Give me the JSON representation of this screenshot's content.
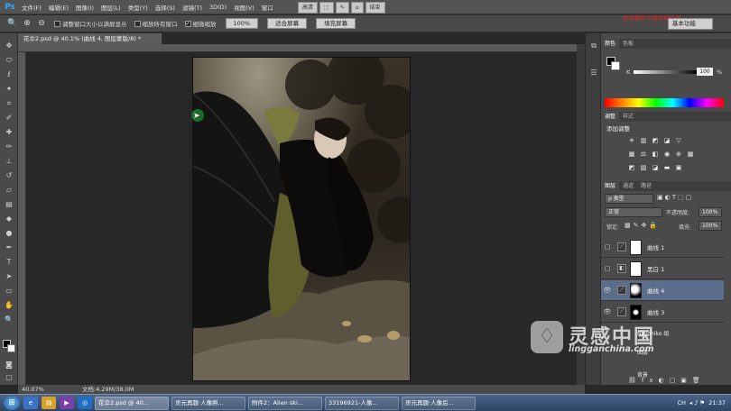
{
  "app": {
    "logo": "Ps"
  },
  "menu": [
    "文件(F)",
    "编辑(E)",
    "图像(I)",
    "图层(L)",
    "类型(Y)",
    "选择(S)",
    "滤镜(T)",
    "3D(D)",
    "视图(V)",
    "窗口"
  ],
  "top_strip": [
    "高清",
    "结束"
  ],
  "workspace_note": "视频教程下载灵感中国",
  "options_bar": {
    "checkboxes": [
      {
        "label": "调整窗口大小以满屏显示",
        "checked": false
      },
      {
        "label": "缩放所有窗口",
        "checked": false
      },
      {
        "label": "细微缩放",
        "checked": true
      }
    ],
    "zoom_value": "100%",
    "fit_button": "适合屏幕",
    "fill_button": "填充屏幕",
    "workspace": "基本功能"
  },
  "document": {
    "tab_title": "花伞2.psd @ 40.1% (曲线 4, 图层蒙版/8) *",
    "zoom_status": "40.07%",
    "doc_size": "文档:4.29M/38.0M"
  },
  "panels": {
    "color_tabs": [
      "颜色",
      "色板"
    ],
    "color_channel": "K",
    "color_value": "100",
    "color_unit": "%",
    "adjust_tabs": [
      "调整",
      "样式"
    ],
    "adjust_title": "添加调整",
    "layers_tabs": [
      "图层",
      "通道",
      "路径"
    ],
    "filter_kind": "类型",
    "blend_mode": "正常",
    "opacity_label": "不透明度:",
    "opacity_value": "100%",
    "lock_label": "锁定:",
    "fill_label": "填充:",
    "fill_value": "100%",
    "layers": [
      {
        "name": "曲线 1",
        "visible": false,
        "selected": false
      },
      {
        "name": "黑白 1",
        "visible": false,
        "selected": false
      },
      {
        "name": "曲线 4",
        "visible": true,
        "selected": true
      },
      {
        "name": "曲线 3",
        "visible": true,
        "selected": false
      }
    ],
    "bottom_layer_labels": [
      "Nkyohiko 组",
      "图层",
      "背景"
    ]
  },
  "watermark": {
    "title": "灵感中国",
    "url": "lingganchina.com"
  },
  "taskbar": {
    "tasks": [
      "花伞2.psd @ 40...",
      "灵元再题·人像照...",
      "附件2：Alien ski...",
      "33196921-人像...",
      "灵元再题·人像后..."
    ],
    "tray_text": "CH",
    "time": "21:37"
  },
  "colors": {
    "ui_bg": "#535353",
    "panel": "#4a4a4a",
    "canvas": "#282828",
    "selected_layer": "#5a6e8c",
    "note_red": "#e02020"
  }
}
